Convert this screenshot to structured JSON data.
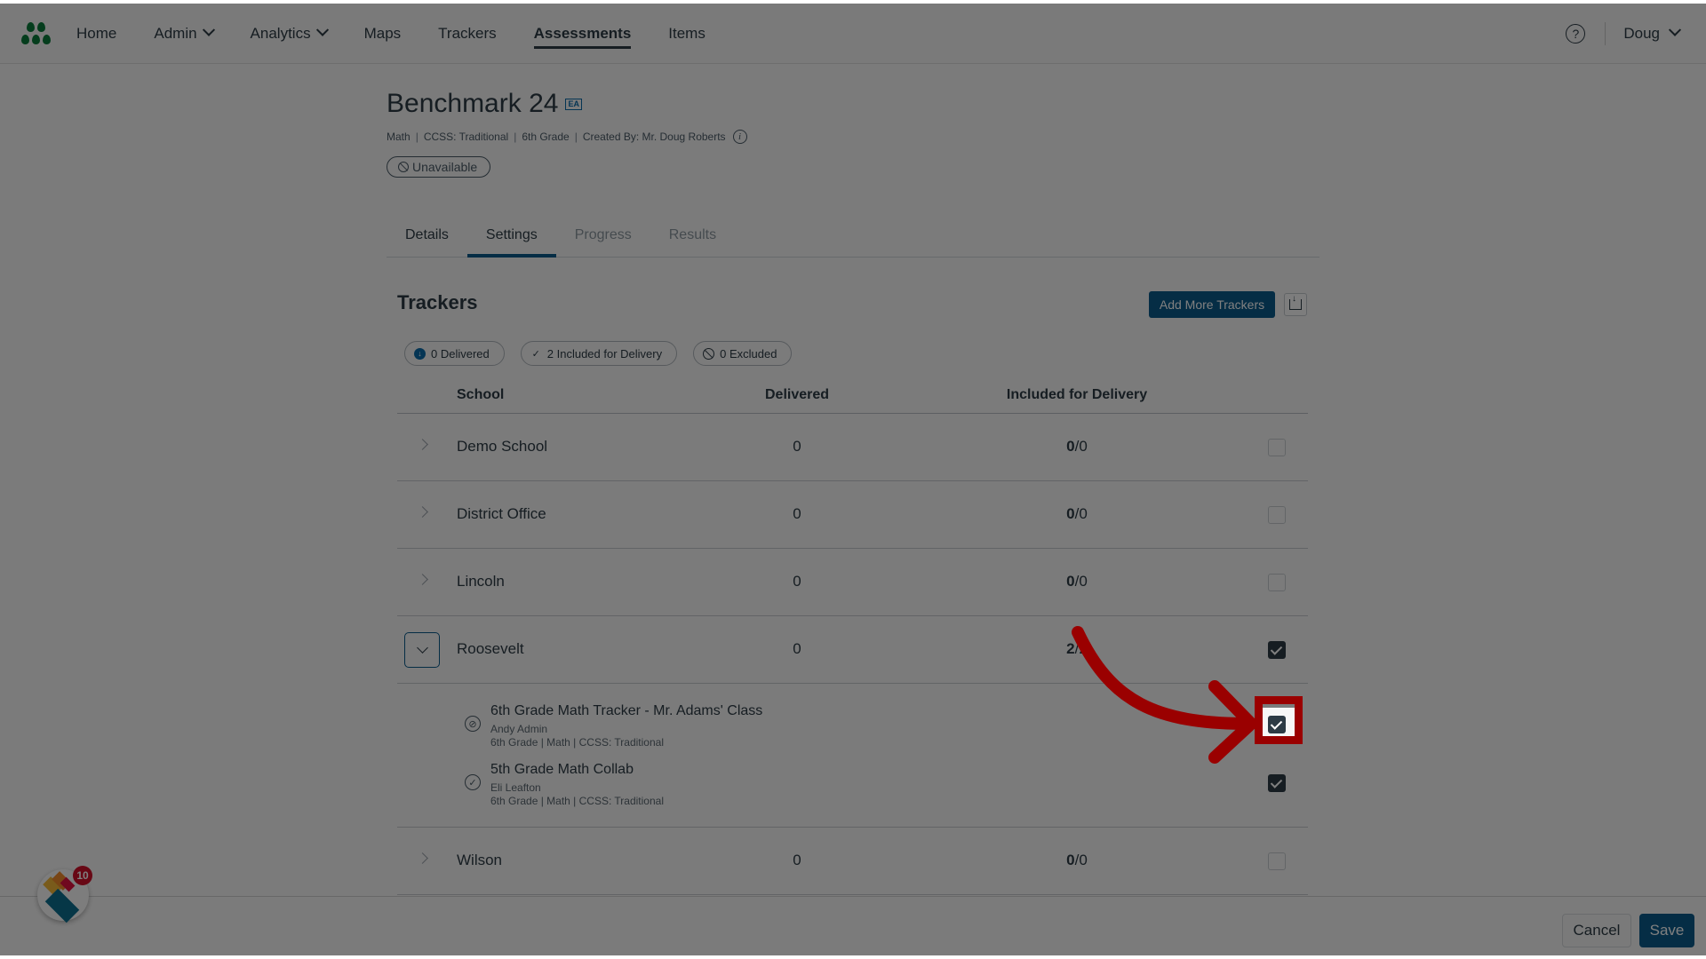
{
  "nav": {
    "items": [
      {
        "label": "Home",
        "has_dropdown": false,
        "active": false
      },
      {
        "label": "Admin",
        "has_dropdown": true,
        "active": false
      },
      {
        "label": "Analytics",
        "has_dropdown": true,
        "active": false
      },
      {
        "label": "Maps",
        "has_dropdown": false,
        "active": false
      },
      {
        "label": "Trackers",
        "has_dropdown": false,
        "active": false
      },
      {
        "label": "Assessments",
        "has_dropdown": false,
        "active": true
      },
      {
        "label": "Items",
        "has_dropdown": false,
        "active": false
      }
    ],
    "help_icon": "question-circle-icon",
    "user": "Doug"
  },
  "header": {
    "title": "Benchmark 24",
    "badge": "EA",
    "meta": [
      "Math",
      "CCSS: Traditional",
      "6th Grade",
      "Created By: Mr. Doug Roberts"
    ],
    "status": "Unavailable"
  },
  "tabs": [
    {
      "label": "Details",
      "state": "enabled"
    },
    {
      "label": "Settings",
      "state": "active"
    },
    {
      "label": "Progress",
      "state": "disabled"
    },
    {
      "label": "Results",
      "state": "disabled"
    }
  ],
  "trackers": {
    "title": "Trackers",
    "add_button": "Add More Trackers",
    "filters": [
      {
        "label": "0 Delivered",
        "icon": "delivered-icon"
      },
      {
        "label": "2 Included for Delivery",
        "icon": "check-icon"
      },
      {
        "label": "0 Excluded",
        "icon": "ban-icon"
      }
    ],
    "columns": [
      "School",
      "Delivered",
      "Included for Delivery"
    ],
    "rows": [
      {
        "school": "Demo School",
        "delivered": "0",
        "included_count": "0",
        "included_total": "/0",
        "checked": false
      },
      {
        "school": "District Office",
        "delivered": "0",
        "included_count": "0",
        "included_total": "/0",
        "checked": false
      },
      {
        "school": "Lincoln",
        "delivered": "0",
        "included_count": "0",
        "included_total": "/0",
        "checked": false
      },
      {
        "school": "Roosevelt",
        "delivered": "0",
        "included_count": "2",
        "included_total": "/2",
        "checked": true,
        "expanded": true
      },
      {
        "school": "Wilson",
        "delivered": "0",
        "included_count": "0",
        "included_total": "/0",
        "checked": false
      }
    ],
    "roosevelt_trackers": [
      {
        "title": "6th Grade Math Tracker - Mr. Adams' Class",
        "owner": "Andy Admin",
        "meta": "6th Grade  |  Math  |  CCSS: Traditional",
        "checked": true,
        "highlighted": true
      },
      {
        "title": "5th Grade Math Collab",
        "owner": "Eli Leafton",
        "meta": "6th Grade  |  Math  |  CCSS: Traditional",
        "checked": true,
        "highlighted": false
      }
    ]
  },
  "footer": {
    "cancel": "Cancel",
    "save": "Save"
  },
  "widget": {
    "notification_count": "10"
  },
  "colors": {
    "primary": "#0b5a8a",
    "logo": "#0b7a3b",
    "annotation": "#9a0000",
    "overlay": "rgba(0,0,0,0.5)"
  }
}
